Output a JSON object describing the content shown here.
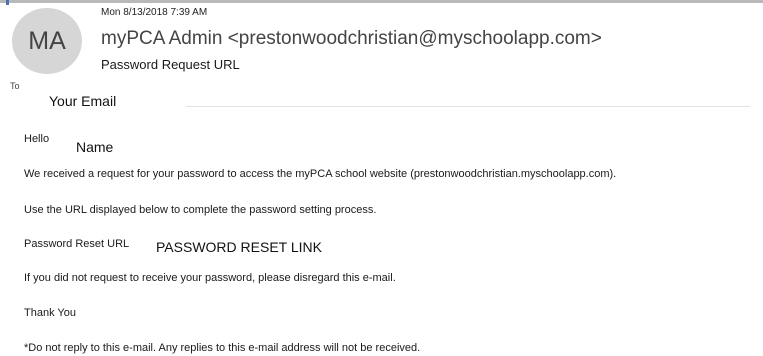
{
  "header": {
    "avatar_initials": "MA",
    "date": "Mon 8/13/2018 7:39 AM",
    "sender": "myPCA Admin <prestonwoodchristian@myschoolapp.com>",
    "subject": "Password Request URL",
    "to_label": "To",
    "recipient": "Your Email"
  },
  "body": {
    "greeting": "Hello",
    "name": "Name",
    "line1": "We received a request for your password to access the myPCA school website (prestonwoodchristian.myschoolapp.com).",
    "line2": "Use the URL displayed below to complete the password setting process.",
    "reset_label": "Password Reset URL",
    "reset_link": "PASSWORD RESET LINK",
    "line3": "If you did not request to receive your password, please disregard this e-mail.",
    "thanks": "Thank You",
    "footer_note": "*Do not reply to this e-mail. Any replies to this e-mail address will not be received."
  },
  "colors": {
    "avatar_bg": "#d6d6d6",
    "sender_text": "#444444",
    "accent": "#4a6fb5"
  }
}
